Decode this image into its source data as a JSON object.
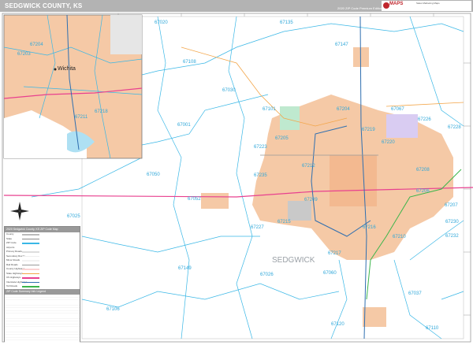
{
  "header": {
    "title": "SEDGWICK COUNTY, KS",
    "edition": "2020 ZIP Code Premium Edition",
    "logo_brand": "MAPS",
    "logo_sub": "Sales Marketing Maps"
  },
  "map": {
    "county_label": "SEDGWICK",
    "zip_labels": [
      "67020",
      "67135",
      "67147",
      "67108",
      "67030",
      "67101",
      "67204",
      "67067",
      "67226",
      "67228",
      "67205",
      "67219",
      "67220",
      "67223",
      "67001",
      "67212",
      "67208",
      "67050",
      "67235",
      "67052",
      "67206",
      "67207",
      "67025",
      "67209",
      "67230",
      "67227",
      "67215",
      "67217",
      "67232",
      "67149",
      "67026",
      "67216",
      "67210",
      "67060",
      "67037",
      "67106",
      "67120",
      "67110"
    ],
    "colors": {
      "city": "#f5c9a6",
      "zip_boundary": "#39b7e6",
      "highway": "#e8408f",
      "interstate": "#2f6fb0",
      "turnpike": "#3ab54a",
      "road": "#f3a64a"
    }
  },
  "inset": {
    "city_label": "Wichita",
    "zip_labels": [
      "67204",
      "67203",
      "67211",
      "67218"
    ]
  },
  "legend": {
    "title": "2020 Sedgwick County, KS ZIP Code Map",
    "items": [
      "County",
      "State",
      "ZIP Code",
      "Airports",
      "Primary Roads",
      "Secondary Roads",
      "Minor Roads",
      "Rail Roads",
      "County Highways",
      "State Highways",
      "US Highways",
      "Interstate Highways",
      "Toll Roads"
    ],
    "table_title": "ZIP Code Summary Info Legend"
  }
}
